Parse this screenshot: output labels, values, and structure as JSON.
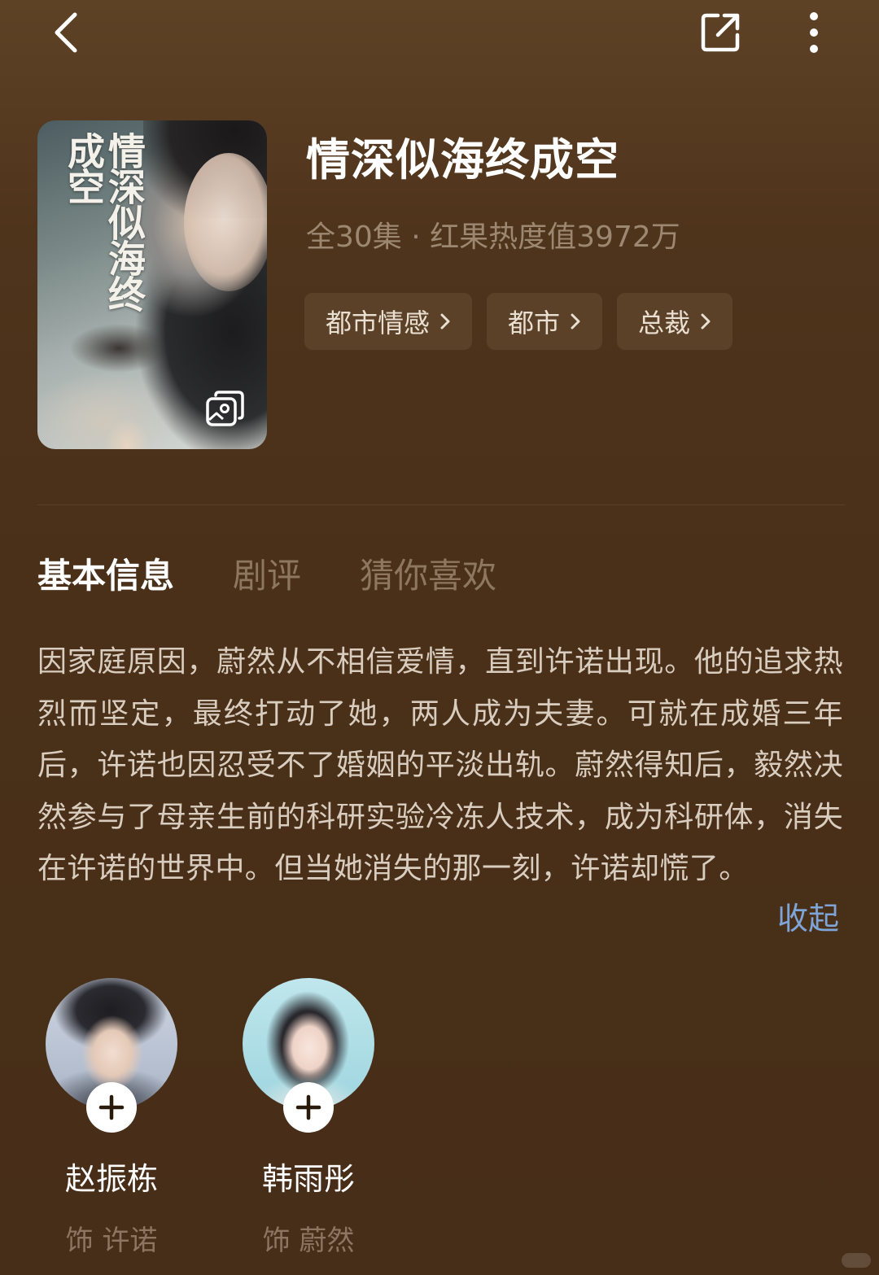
{
  "header": {
    "back_icon": "chevron-left-icon",
    "share_icon": "share-icon",
    "more_icon": "more-vertical-icon"
  },
  "poster": {
    "title_text": "情深似海终成空",
    "gallery_icon": "gallery-icon"
  },
  "drama": {
    "title": "情深似海终成空",
    "meta": "全30集 · 红果热度值3972万",
    "tags": [
      "都市情感",
      "都市",
      "总裁"
    ]
  },
  "tabs": [
    "基本信息",
    "剧评",
    "猜你喜欢"
  ],
  "synopsis": {
    "text": "因家庭原因，蔚然从不相信爱情，直到许诺出现。他的追求热烈而坚定，最终打动了她，两人成为夫妻。可就在成婚三年后，许诺也因忍受不了婚姻的平淡出轨。蔚然得知后，毅然决然参与了母亲生前的科研实验冷冻人技术，成为科研体，消失在许诺的世界中。但当她消失的那一刻，许诺却慌了。",
    "collapse_label": "收起"
  },
  "cast": [
    {
      "name": "赵振栋",
      "role": "饰 许诺"
    },
    {
      "name": "韩雨彤",
      "role": "饰 蔚然"
    }
  ],
  "colors": {
    "background": "#4a3019",
    "tag_bg": "#5c4129",
    "link": "#7ea4d8",
    "muted_text": "#9c8771"
  }
}
